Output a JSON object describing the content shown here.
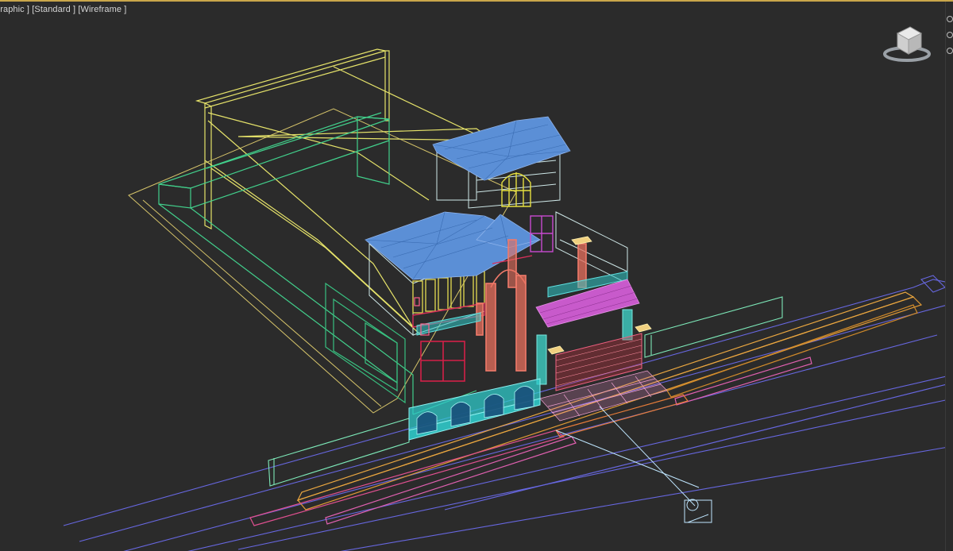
{
  "viewport": {
    "label_parts": [
      "graphic ]",
      "[Standard ]",
      "[Wireframe ]"
    ],
    "view_mode": "Orthographic",
    "shading": "Wireframe",
    "preset": "Standard"
  },
  "viewcube": {
    "icon": "viewcube-icon",
    "face_label": ""
  },
  "scene": {
    "description_objects": [
      "building-wireframe",
      "roof",
      "columns",
      "gate",
      "road",
      "camera"
    ],
    "colors": {
      "background": "#2b2b2b",
      "roof_blue": "#5b8fd6",
      "column_salmon": "#f07a6a",
      "arch_cyan": "#2fc9c9",
      "magenta_roof": "#d25fd0",
      "yellow_frame": "#d8d85a",
      "green_frame": "#3ecf9a",
      "orange_curb": "#e0a040",
      "pink_curb": "#e060a0",
      "road_blue": "#6f6fe8"
    }
  }
}
